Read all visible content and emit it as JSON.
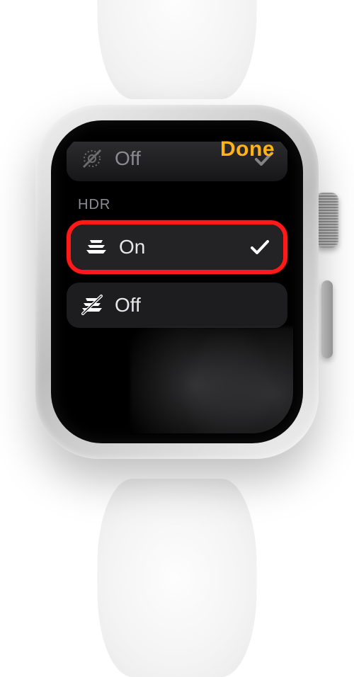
{
  "header": {
    "done_label": "Done"
  },
  "previous_group": {
    "off_label": "Off",
    "selected": true
  },
  "hdr": {
    "title": "HDR",
    "options": [
      {
        "label": "On",
        "selected": true
      },
      {
        "label": "Off",
        "selected": false
      }
    ]
  },
  "colors": {
    "accent": "#ffb317",
    "highlight": "#ff1a1a"
  }
}
